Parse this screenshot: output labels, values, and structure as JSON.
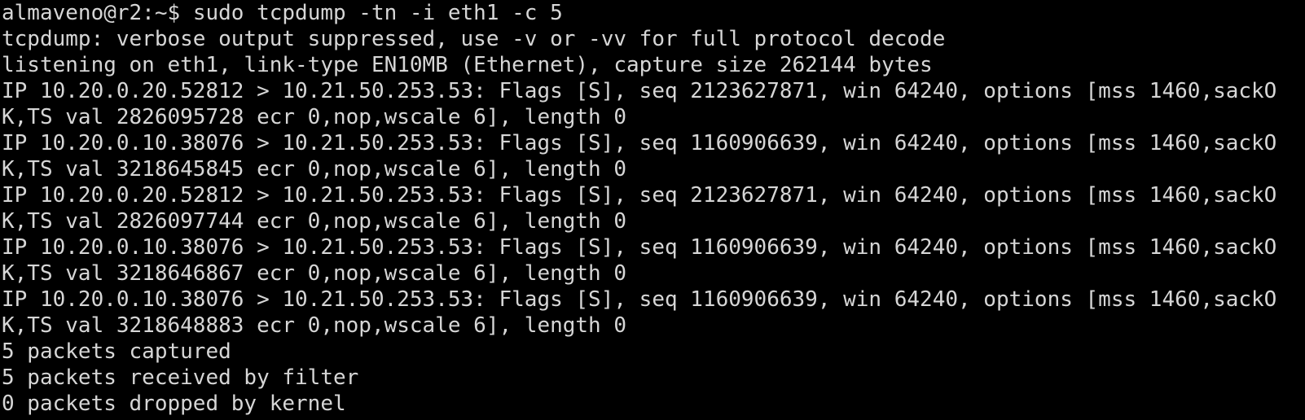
{
  "terminal": {
    "prompt": "almaveno@r2:~$ ",
    "command": "sudo tcpdump -tn -i eth1 -c 5",
    "lines": [
      "tcpdump: verbose output suppressed, use -v or -vv for full protocol decode",
      "listening on eth1, link-type EN10MB (Ethernet), capture size 262144 bytes",
      "IP 10.20.0.20.52812 > 10.21.50.253.53: Flags [S], seq 2123627871, win 64240, options [mss 1460,sackO",
      "K,TS val 2826095728 ecr 0,nop,wscale 6], length 0",
      "IP 10.20.0.10.38076 > 10.21.50.253.53: Flags [S], seq 1160906639, win 64240, options [mss 1460,sackO",
      "K,TS val 3218645845 ecr 0,nop,wscale 6], length 0",
      "IP 10.20.0.20.52812 > 10.21.50.253.53: Flags [S], seq 2123627871, win 64240, options [mss 1460,sackO",
      "K,TS val 2826097744 ecr 0,nop,wscale 6], length 0",
      "IP 10.20.0.10.38076 > 10.21.50.253.53: Flags [S], seq 1160906639, win 64240, options [mss 1460,sackO",
      "K,TS val 3218646867 ecr 0,nop,wscale 6], length 0",
      "IP 10.20.0.10.38076 > 10.21.50.253.53: Flags [S], seq 1160906639, win 64240, options [mss 1460,sackO",
      "K,TS val 3218648883 ecr 0,nop,wscale 6], length 0",
      "5 packets captured",
      "5 packets received by filter",
      "0 packets dropped by kernel"
    ]
  }
}
